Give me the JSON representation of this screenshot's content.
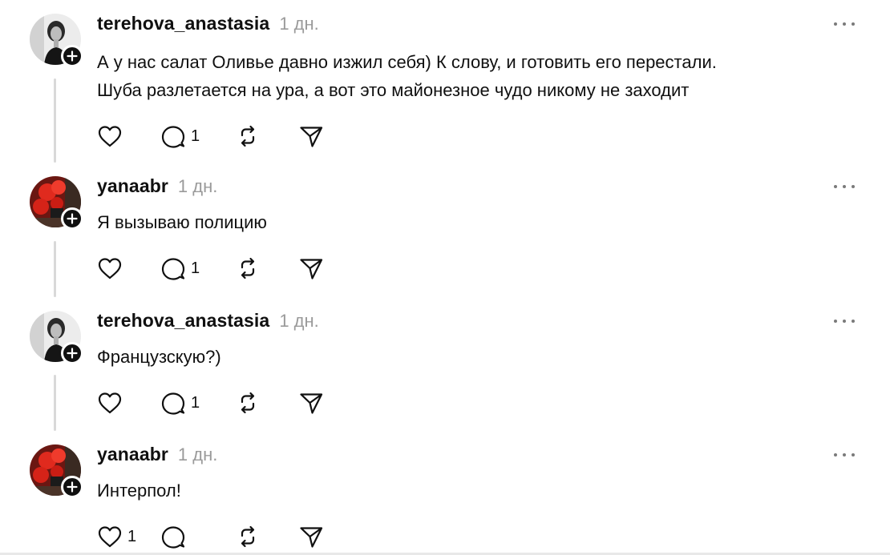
{
  "posts": [
    {
      "username": "terehova_anastasia",
      "time": "1 дн.",
      "text_lines": [
        "А у нас салат Оливье давно изжил себя) К слову, и готовить его перестали.",
        "Шуба разлетается на ура, а вот это майонезное чудо никому не заходит"
      ],
      "likes": "",
      "replies": "1"
    },
    {
      "username": "yanaabr",
      "time": "1 дн.",
      "text_lines": [
        "Я вызываю полицию"
      ],
      "likes": "",
      "replies": "1"
    },
    {
      "username": "terehova_anastasia",
      "time": "1 дн.",
      "text_lines": [
        "Французскую?)"
      ],
      "likes": "",
      "replies": "1"
    },
    {
      "username": "yanaabr",
      "time": "1 дн.",
      "text_lines": [
        "Интерпол!"
      ],
      "likes": "1",
      "replies": ""
    }
  ],
  "icons": {
    "like": "heart-icon",
    "reply": "speech-bubble-icon",
    "repost": "repost-arrows-icon",
    "share": "paper-plane-icon",
    "more": "more-dots-icon",
    "follow": "plus-icon"
  },
  "colors": {
    "text": "#101010",
    "muted": "#9a9a9a",
    "thread_line": "#d9d9d9"
  }
}
